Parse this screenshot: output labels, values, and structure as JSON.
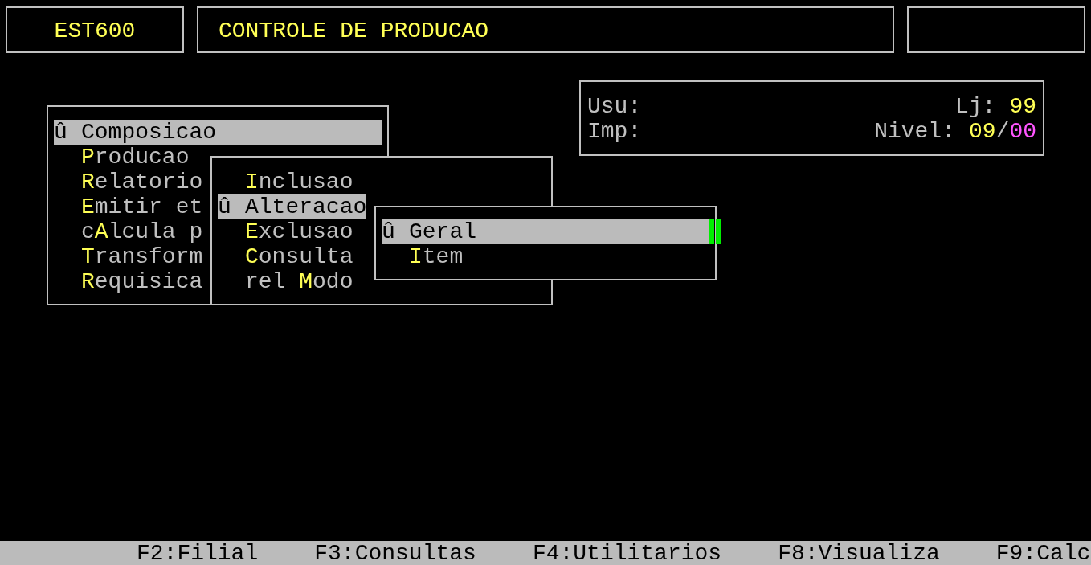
{
  "header": {
    "code": "EST600",
    "title": "CONTROLE DE PRODUCAO"
  },
  "info": {
    "user_label": "Usu:",
    "printer_label": "Imp:",
    "store_label": "Lj:",
    "store": "99",
    "level_label": "Nivel:",
    "level_value": "09",
    "level_sep": "/",
    "level_max": "00"
  },
  "menus": [
    {
      "items": [
        {
          "marker": "û",
          "key": "C",
          "after": "omposicao",
          "selected": true
        },
        {
          "key": "P",
          "after": "roducao",
          "selected": false
        },
        {
          "key": "R",
          "after": "elatorio",
          "selected": false
        },
        {
          "key": "E",
          "after": "mitir et",
          "selected": false
        },
        {
          "before": "c",
          "key": "A",
          "after": "lcula p",
          "selected": false
        },
        {
          "key": "T",
          "after": "ransform",
          "selected": false
        },
        {
          "key": "R",
          "after": "equisica",
          "selected": false
        }
      ]
    },
    {
      "items": [
        {
          "key": "I",
          "after": "nclusao",
          "selected": false
        },
        {
          "marker": "û",
          "key": "A",
          "after": "lteracao",
          "selected": true
        },
        {
          "key": "E",
          "after": "xclusao",
          "selected": false
        },
        {
          "key": "C",
          "after": "onsulta",
          "selected": false
        },
        {
          "before": "rel ",
          "key": "M",
          "after": "odo",
          "selected": false
        }
      ]
    },
    {
      "items": [
        {
          "marker": "û",
          "key": "G",
          "after": "eral",
          "selected": true
        },
        {
          "key": "I",
          "after": "tem",
          "selected": false
        }
      ]
    }
  ],
  "function_keys": [
    "F2:Filial",
    "F3:Consultas",
    "F4:Utilitarios",
    "F8:Visualiza",
    "F9:Calc"
  ]
}
